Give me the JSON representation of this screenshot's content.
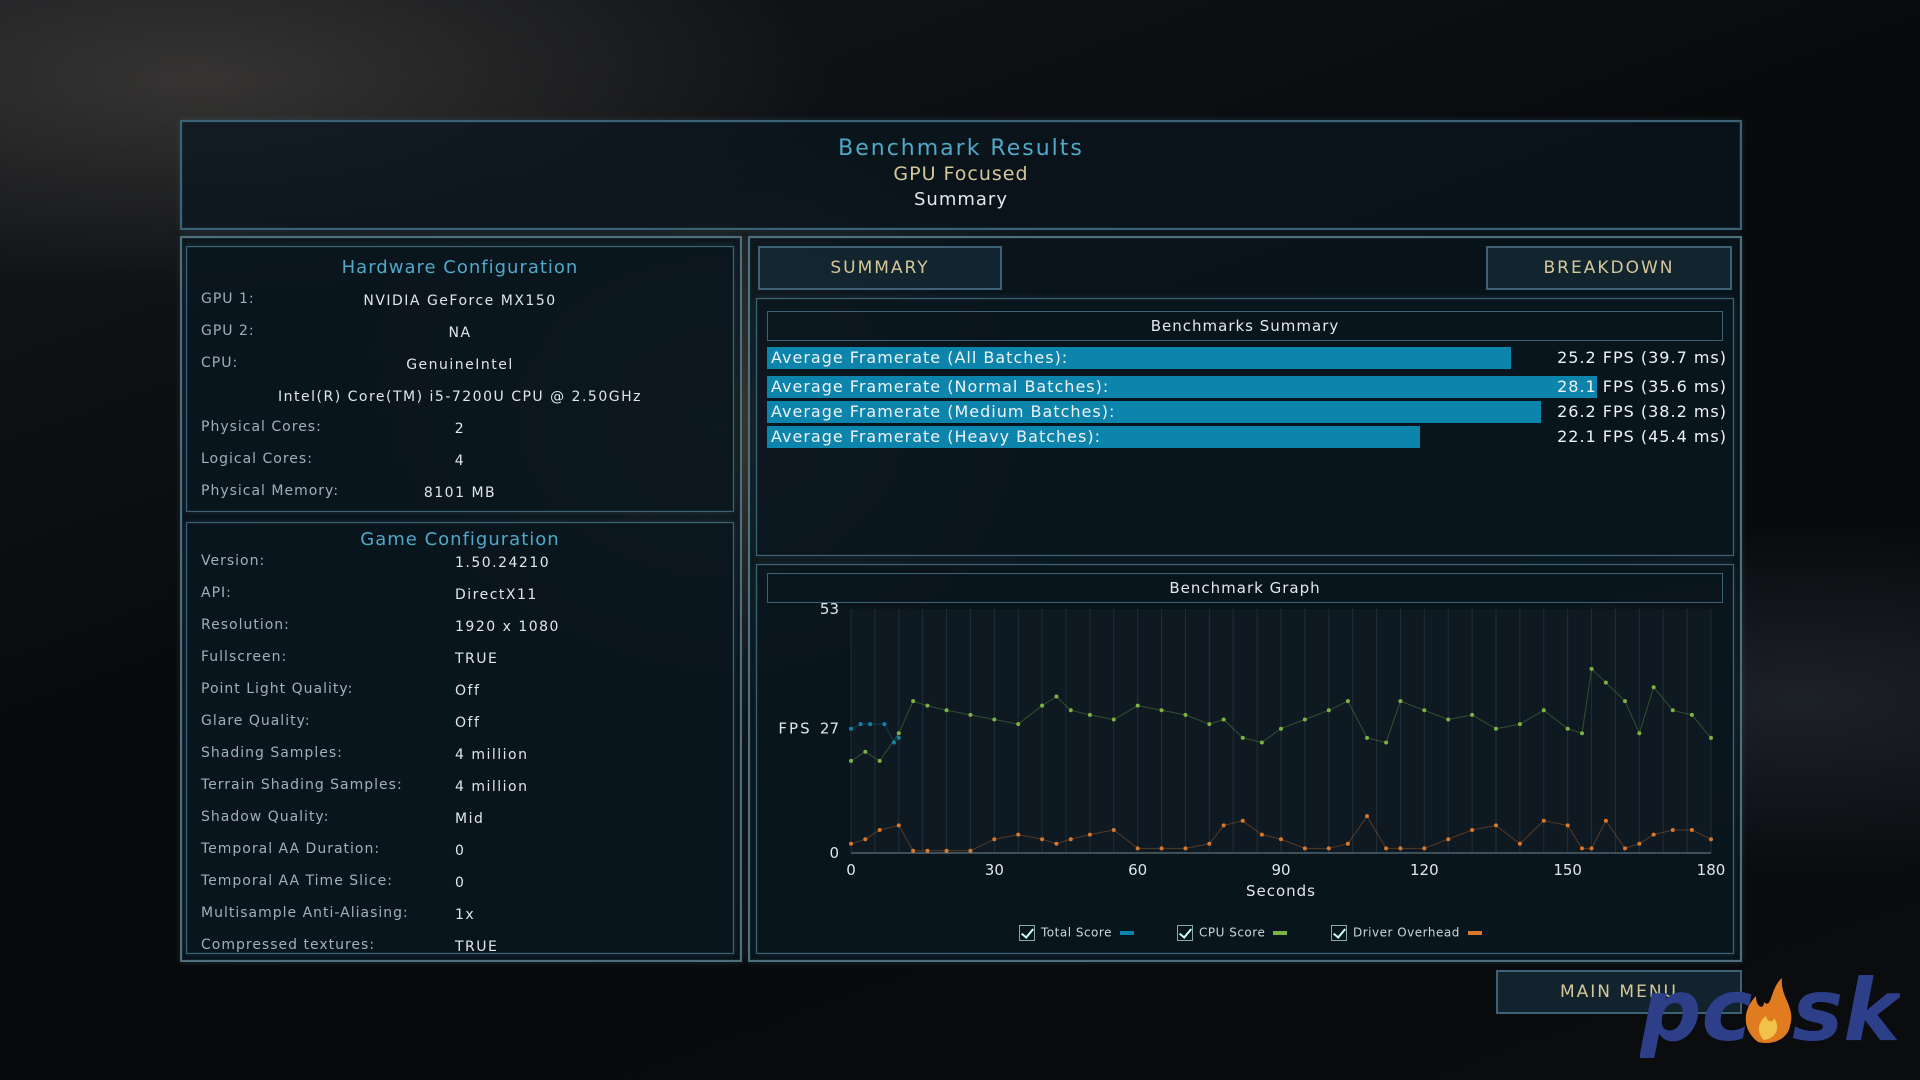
{
  "header": {
    "title": "Benchmark Results",
    "subtitle": "GPU Focused",
    "view": "Summary"
  },
  "hardware": {
    "title": "Hardware Configuration",
    "items": [
      {
        "label": "GPU 1:",
        "value": "NVIDIA GeForce MX150"
      },
      {
        "label": "GPU 2:",
        "value": "NA"
      },
      {
        "label": "CPU:",
        "value": "GenuineIntel"
      },
      {
        "label": "",
        "value": "Intel(R) Core(TM) i5-7200U CPU @ 2.50GHz"
      },
      {
        "label": "Physical Cores:",
        "value": "2"
      },
      {
        "label": "Logical Cores:",
        "value": "4"
      },
      {
        "label": "Physical Memory:",
        "value": "8101  MB"
      }
    ]
  },
  "game": {
    "title": "Game Configuration",
    "items": [
      {
        "label": "Version:",
        "value": "1.50.24210"
      },
      {
        "label": "API:",
        "value": "DirectX11"
      },
      {
        "label": "Resolution:",
        "value": "1920 x 1080"
      },
      {
        "label": "Fullscreen:",
        "value": "TRUE"
      },
      {
        "label": "Point Light Quality:",
        "value": "Off"
      },
      {
        "label": "Glare Quality:",
        "value": "Off"
      },
      {
        "label": "Shading Samples:",
        "value": "4 million"
      },
      {
        "label": "Terrain Shading Samples:",
        "value": "4 million"
      },
      {
        "label": "Shadow Quality:",
        "value": "Mid"
      },
      {
        "label": "Temporal AA Duration:",
        "value": "0"
      },
      {
        "label": "Temporal AA Time Slice:",
        "value": "0"
      },
      {
        "label": "Multisample Anti-Aliasing:",
        "value": "1x"
      },
      {
        "label": "Compressed textures:",
        "value": "TRUE"
      }
    ]
  },
  "tabs": {
    "summary": "SUMMARY",
    "breakdown": "BREAKDOWN"
  },
  "summary": {
    "title": "Benchmarks Summary",
    "rows": [
      {
        "label": "Average Framerate (All Batches):",
        "value": "25.2 FPS (39.7 ms)",
        "fps": 25.2
      },
      {
        "label": "Average Framerate (Normal Batches):",
        "value": "28.1 FPS (35.6 ms)",
        "fps": 28.1
      },
      {
        "label": "Average Framerate (Medium Batches):",
        "value": "26.2 FPS (38.2 ms)",
        "fps": 26.2
      },
      {
        "label": "Average Framerate (Heavy Batches):",
        "value": "22.1 FPS (45.4 ms)",
        "fps": 22.1
      }
    ],
    "bar_max_fps": 32.5
  },
  "graph": {
    "title": "Benchmark Graph",
    "ylabel": "FPS",
    "xlabel": "Seconds",
    "legend": [
      {
        "label": "Total Score",
        "color": "#0d84ab"
      },
      {
        "label": "CPU Score",
        "color": "#7cb342"
      },
      {
        "label": "Driver Overhead",
        "color": "#d9782a"
      }
    ]
  },
  "chart_data": {
    "type": "scatter",
    "title": "Benchmark Graph",
    "xlabel": "Seconds",
    "ylabel": "FPS",
    "xlim": [
      0,
      180
    ],
    "ylim": [
      0,
      53
    ],
    "xticks": [
      0,
      30,
      60,
      90,
      120,
      150,
      180
    ],
    "yticks": [
      0,
      27,
      53
    ],
    "series": [
      {
        "name": "Total Score",
        "x": [
          0,
          2,
          4,
          7,
          9,
          10
        ],
        "y": [
          27,
          28,
          28,
          28,
          24,
          25
        ]
      },
      {
        "name": "CPU Score",
        "x": [
          0,
          3,
          6,
          10,
          13,
          16,
          20,
          25,
          30,
          35,
          40,
          43,
          46,
          50,
          55,
          60,
          65,
          70,
          75,
          78,
          82,
          86,
          90,
          95,
          100,
          104,
          108,
          112,
          115,
          120,
          125,
          130,
          135,
          140,
          145,
          150,
          153,
          155,
          158,
          162,
          165,
          168,
          172,
          176,
          180
        ],
        "y": [
          20,
          22,
          20,
          26,
          33,
          32,
          31,
          30,
          29,
          28,
          32,
          34,
          31,
          30,
          29,
          32,
          31,
          30,
          28,
          29,
          25,
          24,
          27,
          29,
          31,
          33,
          25,
          24,
          33,
          31,
          29,
          30,
          27,
          28,
          31,
          27,
          26,
          40,
          37,
          33,
          26,
          36,
          31,
          30,
          25
        ]
      },
      {
        "name": "Driver Overhead",
        "x": [
          0,
          3,
          6,
          10,
          13,
          16,
          20,
          25,
          30,
          35,
          40,
          43,
          46,
          50,
          55,
          60,
          65,
          70,
          75,
          78,
          82,
          86,
          90,
          95,
          100,
          104,
          108,
          112,
          115,
          120,
          125,
          130,
          135,
          140,
          145,
          150,
          153,
          155,
          158,
          162,
          165,
          168,
          172,
          176,
          180
        ],
        "y": [
          2,
          3,
          5,
          6,
          0.5,
          0.5,
          0.5,
          0.5,
          3,
          4,
          3,
          2,
          3,
          4,
          5,
          1,
          1,
          1,
          2,
          6,
          7,
          4,
          3,
          1,
          1,
          2,
          8,
          1,
          1,
          1,
          3,
          5,
          6,
          2,
          7,
          6,
          1,
          1,
          7,
          1,
          2,
          4,
          5,
          5,
          3
        ]
      }
    ]
  },
  "main_menu": "MAIN MENU",
  "watermark": "pcask"
}
